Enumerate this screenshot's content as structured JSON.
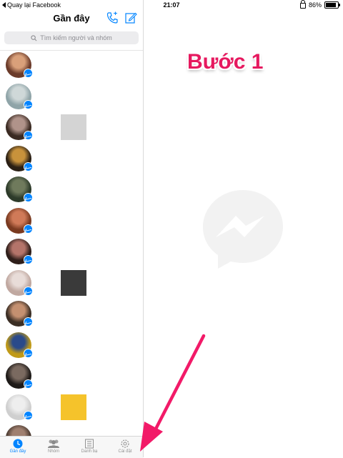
{
  "status_bar": {
    "back_label": "Quay lại Facebook",
    "time": "21:07",
    "battery": "86%",
    "battery_level": 0.86
  },
  "header": {
    "title": "Gần đây"
  },
  "search": {
    "placeholder": "Tìm kiếm người và nhóm"
  },
  "conversations": [
    {
      "avatar": [
        "#6b3b2a",
        "#d9a07a"
      ]
    },
    {
      "avatar": [
        "#8fa4a8",
        "#cfd8d8"
      ]
    },
    {
      "avatar": [
        "#3a2a22",
        "#b0938a"
      ],
      "thumb": "#d4d4d4"
    },
    {
      "avatar": [
        "#2a1f14",
        "#c8923b"
      ]
    },
    {
      "avatar": [
        "#2d3b2a",
        "#6f7a5c"
      ]
    },
    {
      "avatar": [
        "#7a3a20",
        "#d07a58"
      ]
    },
    {
      "avatar": [
        "#2e1e1a",
        "#b4746a"
      ]
    },
    {
      "avatar": [
        "#c0a8a0",
        "#e8dcd8"
      ],
      "thumb": "#3a3a3a"
    },
    {
      "avatar": [
        "#3b2e24",
        "#c49070"
      ]
    },
    {
      "avatar": [
        "#c09a18",
        "#2a4a8a"
      ]
    },
    {
      "avatar": [
        "#1e1a18",
        "#7a6a60"
      ]
    },
    {
      "avatar": [
        "#cfcfcf",
        "#eeeeee"
      ],
      "thumb": "#f5c32b"
    },
    {
      "avatar": [
        "#4a3a30",
        "#a08070"
      ]
    }
  ],
  "tabs": [
    {
      "label": "Gần đây",
      "icon": "clock-icon",
      "active": true
    },
    {
      "label": "Nhóm",
      "icon": "group-icon"
    },
    {
      "label": "Danh bạ",
      "icon": "contacts-icon"
    },
    {
      "label": "Cài đặt",
      "icon": "gear-icon"
    }
  ],
  "overlay": {
    "step_label": "Bước 1"
  },
  "colors": {
    "accent": "#0084ff",
    "annotation": "#e6195f"
  }
}
